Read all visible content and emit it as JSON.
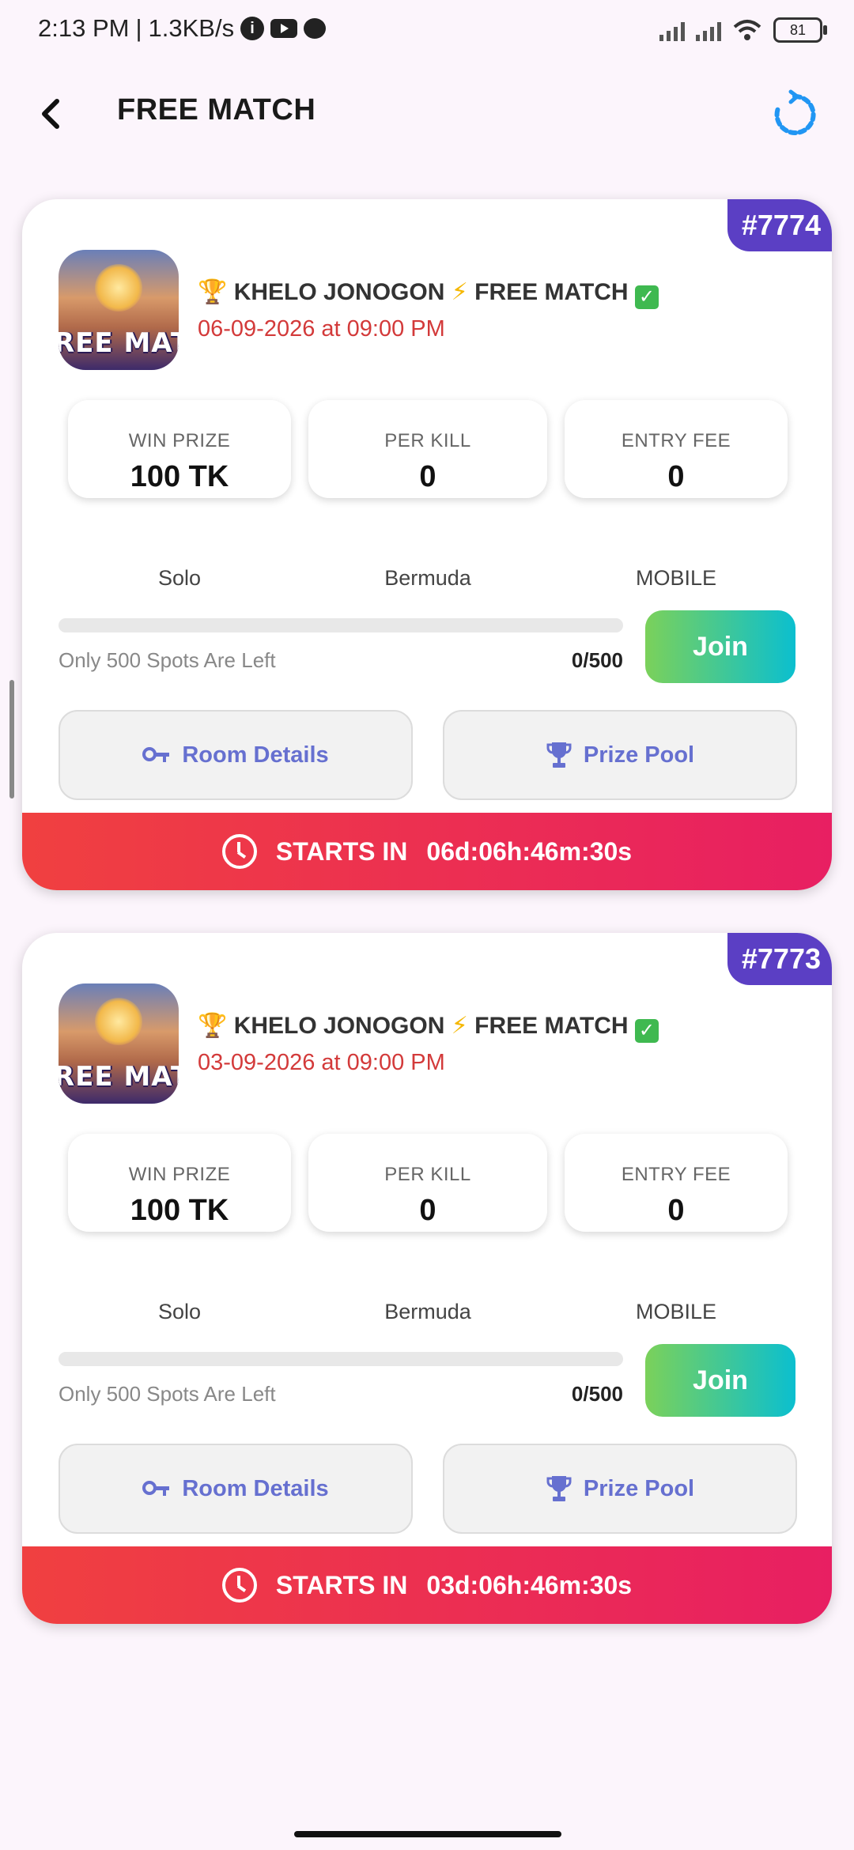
{
  "status_bar": {
    "time": "2:13 PM",
    "separator": "|",
    "speed": "1.3KB/s",
    "battery": "81"
  },
  "header": {
    "title": "FREE MATCH"
  },
  "matches": [
    {
      "id": "#7774",
      "thumbnail_text": "REE MATC",
      "title_prefix": "🏆",
      "title_part1": "KHELO JONOGON",
      "title_sep": "⚡",
      "title_part2": "FREE MATCH",
      "title_check": "✓",
      "date": "06-09-2026 at 09:00 PM",
      "stats": [
        {
          "label": "WIN PRIZE",
          "value": "100 TK"
        },
        {
          "label": "PER KILL",
          "value": "0"
        },
        {
          "label": "ENTRY FEE",
          "value": "0"
        }
      ],
      "type": "Solo",
      "map": "Bermuda",
      "platform": "MOBILE",
      "spots_left_text": "Only 500 Spots Are Left",
      "spots_count": "0/500",
      "progress": 0,
      "join_label": "Join",
      "room_details_label": "Room Details",
      "prize_pool_label": "Prize Pool",
      "starts_in_label": "STARTS IN",
      "countdown": "06d:06h:46m:30s"
    },
    {
      "id": "#7773",
      "thumbnail_text": "REE MATC",
      "title_prefix": "🏆",
      "title_part1": "KHELO JONOGON",
      "title_sep": "⚡",
      "title_part2": "FREE MATCH",
      "title_check": "✓",
      "date": "03-09-2026 at 09:00 PM",
      "stats": [
        {
          "label": "WIN PRIZE",
          "value": "100 TK"
        },
        {
          "label": "PER KILL",
          "value": "0"
        },
        {
          "label": "ENTRY FEE",
          "value": "0"
        }
      ],
      "type": "Solo",
      "map": "Bermuda",
      "platform": "MOBILE",
      "spots_left_text": "Only 500 Spots Are Left",
      "spots_count": "0/500",
      "progress": 0,
      "join_label": "Join",
      "room_details_label": "Room Details",
      "prize_pool_label": "Prize Pool",
      "starts_in_label": "STARTS IN",
      "countdown": "03d:06h:46m:30s"
    }
  ],
  "colors": {
    "background": "#fcf5fc",
    "match_id_badge": "#5b3fc4",
    "date_text": "#d33a3a",
    "join_gradient_start": "#7bd15a",
    "join_gradient_end": "#0bbfcf",
    "action_text": "#6670d0",
    "starts_bar_start": "#f04040",
    "starts_bar_end": "#e81f62",
    "refresh_icon": "#2196f3"
  },
  "icons": {
    "back": "back-arrow-icon",
    "refresh": "refresh-icon",
    "room_details": "key-icon",
    "prize_pool": "trophy-icon",
    "starts_in": "clock-icon"
  }
}
